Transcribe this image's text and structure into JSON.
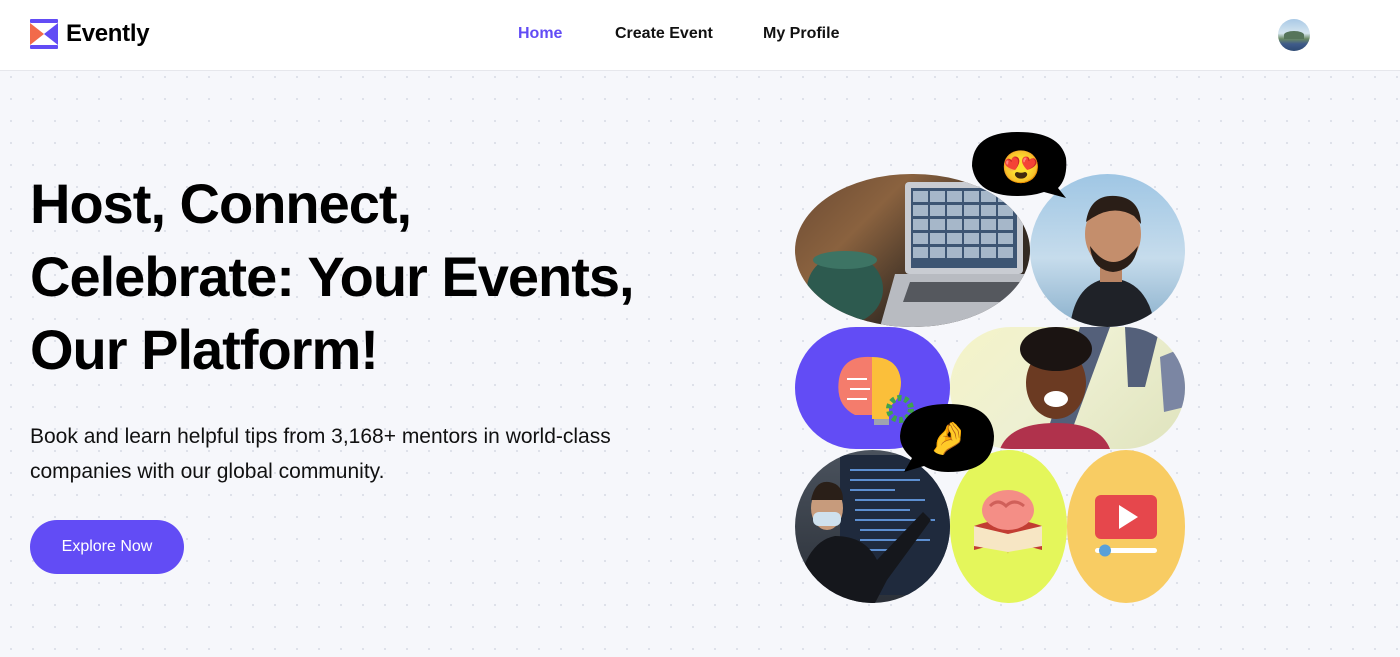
{
  "brand": {
    "name": "Evently",
    "colors": {
      "primary": "#624cf5",
      "logo_orange": "#f26a4b"
    }
  },
  "nav": {
    "home": "Home",
    "create_event": "Create Event",
    "my_profile": "My Profile",
    "active": "Home"
  },
  "hero": {
    "title_line1": "Host, Connect,",
    "title_line2": "Celebrate: Your Events,",
    "title_line3": "Our Platform!",
    "subtitle": "Book and learn helpful tips from 3,168+ mentors in world-class companies with our global community.",
    "cta_label": "Explore Now"
  },
  "collage": {
    "bubble_emojis": [
      "😍",
      "🤌"
    ],
    "icons": [
      "brain-lightbulb-icon",
      "brain-book-icon",
      "video-play-icon"
    ]
  }
}
